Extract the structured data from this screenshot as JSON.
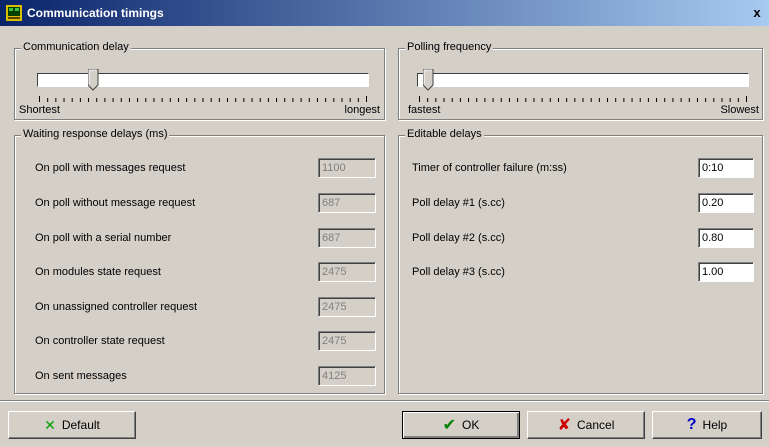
{
  "window": {
    "title": "Communication timings",
    "close_label": "x"
  },
  "communication_delay": {
    "label": "Communication delay",
    "min_label": "Shortest",
    "max_label": "longest",
    "level": 0.16
  },
  "polling_frequency": {
    "label": "Polling frequency",
    "min_label": "fastest",
    "max_label": "Slowest",
    "level": 0.02
  },
  "waiting_response_delays": {
    "label": "Waiting response delays (ms)",
    "rows": [
      {
        "label": "On poll with messages request",
        "value": "1100"
      },
      {
        "label": "On poll without message request",
        "value": "687"
      },
      {
        "label": "On poll with a serial number",
        "value": "687"
      },
      {
        "label": "On modules state request",
        "value": "2475"
      },
      {
        "label": "On unassigned controller request",
        "value": "2475"
      },
      {
        "label": "On controller state request",
        "value": "2475"
      },
      {
        "label": "On sent messages",
        "value": "4125"
      }
    ]
  },
  "editable_delays": {
    "label": "Editable delays",
    "rows": [
      {
        "label": "Timer of controller failure (m:ss)",
        "value": "0:10"
      },
      {
        "label": "Poll delay #1 (s.cc)",
        "value": "0.20"
      },
      {
        "label": "Poll delay #2 (s.cc)",
        "value": "0.80"
      },
      {
        "label": "Poll delay #3 (s.cc)",
        "value": "1.00"
      }
    ]
  },
  "buttons": {
    "default_label": "Default",
    "ok_label": "OK",
    "cancel_label": "Cancel",
    "help_label": "Help"
  },
  "colors": {
    "title_gradient_start": "#0a246a",
    "title_gradient_end": "#a6caf0",
    "dialog_bg": "#d4d0c8",
    "ok_check": "#008000",
    "cancel_x": "#cc0000",
    "default_x": "#00a000",
    "help_icon": "#0000cc"
  },
  "icons": {
    "app": "app-icon",
    "default": "green-x-icon",
    "ok": "checkmark-icon",
    "cancel": "red-x-icon",
    "help": "question-mark-icon"
  }
}
